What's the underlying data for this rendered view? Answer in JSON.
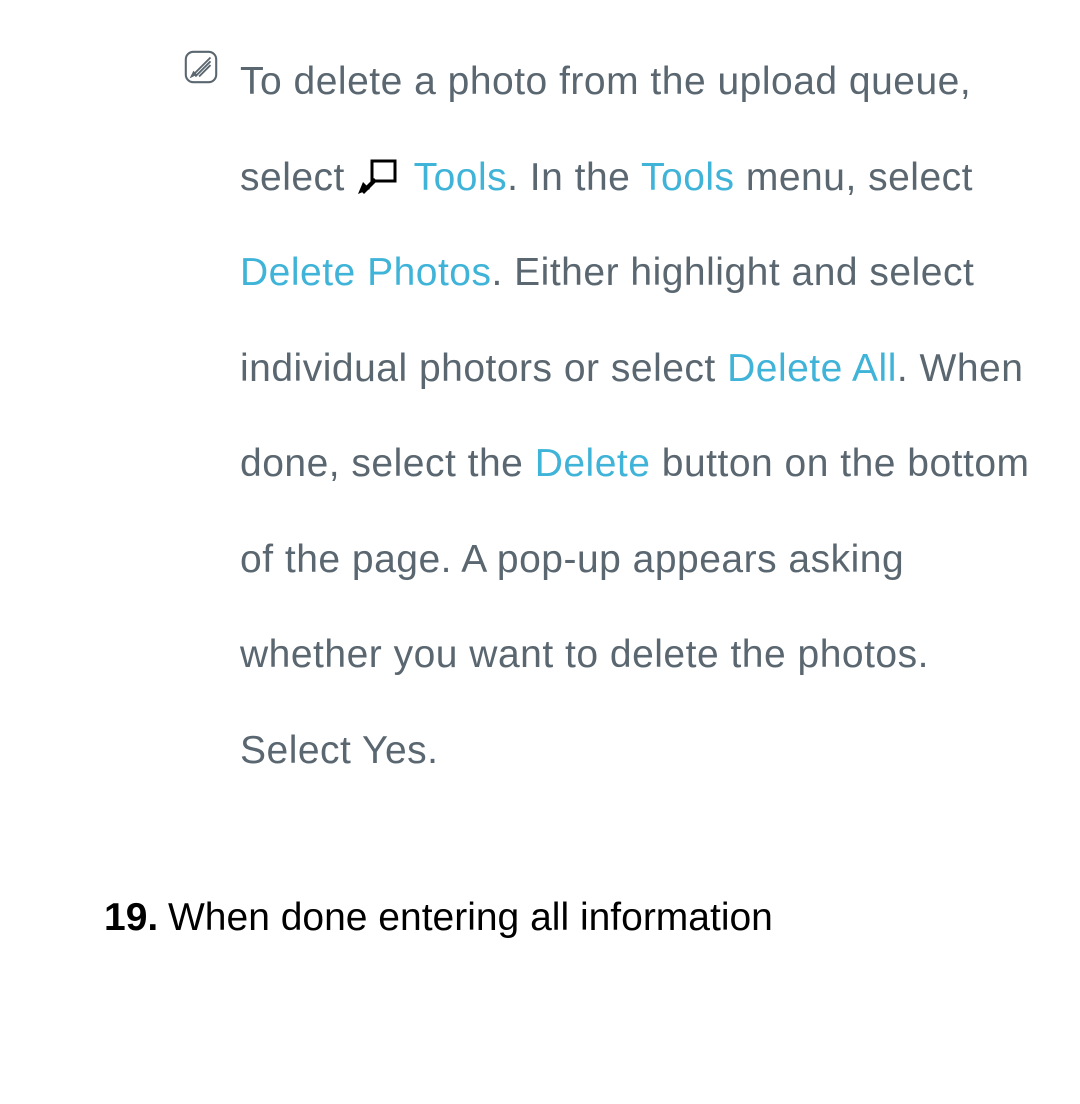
{
  "note": {
    "seg1": "To delete a photo from the upload queue, select ",
    "tools1": "Tools",
    "seg2": ". In the ",
    "tools2": "Tools",
    "seg3": " menu, select ",
    "deletePhotos": "Delete Photos",
    "seg4": ". Either highlight and select individual photors or select ",
    "deleteAll": "Delete All",
    "seg5": ". When done, select the ",
    "delete": "Delete",
    "seg6": " button on the bottom of the page. A pop-up appears asking whether you want to delete the photos. Select Yes."
  },
  "step": {
    "number": "19.",
    "text": "When done entering all information"
  }
}
